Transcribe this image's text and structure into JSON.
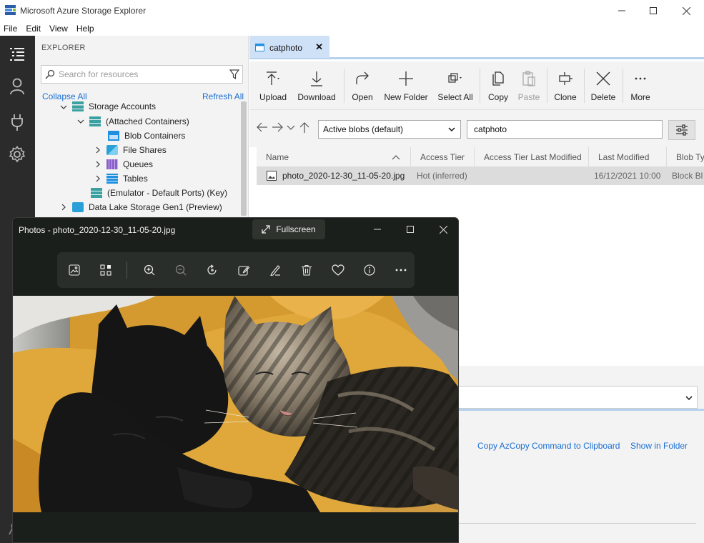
{
  "window": {
    "title": "Microsoft Azure Storage Explorer",
    "minimize_icon": "minimize-icon",
    "maximize_icon": "maximize-icon",
    "close_icon": "close-icon"
  },
  "menu": [
    "File",
    "Edit",
    "View",
    "Help"
  ],
  "activity_bar": [
    "explorer-icon",
    "account-icon",
    "plug-icon",
    "settings-icon"
  ],
  "explorer": {
    "title": "EXPLORER",
    "search_placeholder": "Search for resources",
    "collapse_all": "Collapse All",
    "refresh_all": "Refresh All",
    "tree": [
      {
        "label": "Storage Accounts",
        "expanded": true
      },
      {
        "label": "(Attached Containers)",
        "expanded": true
      },
      {
        "label": "Blob Containers"
      },
      {
        "label": "File Shares",
        "expanded": false
      },
      {
        "label": "Queues",
        "expanded": false
      },
      {
        "label": "Tables",
        "expanded": false
      },
      {
        "label": "(Emulator - Default Ports) (Key)"
      },
      {
        "label": "Data Lake Storage Gen1 (Preview)",
        "expanded": false
      }
    ]
  },
  "tab": {
    "label": "catphoto",
    "close": "✕"
  },
  "toolbar": {
    "upload": "Upload",
    "download": "Download",
    "open": "Open",
    "new_folder": "New Folder",
    "select_all": "Select All",
    "copy": "Copy",
    "paste": "Paste",
    "clone": "Clone",
    "delete": "Delete",
    "more": "More"
  },
  "nav": {
    "view_select": "Active blobs (default)",
    "path": "catphoto"
  },
  "grid": {
    "columns": [
      "Name",
      "Access Tier",
      "Access Tier Last Modified",
      "Last Modified",
      "Blob Ty"
    ],
    "rows": [
      {
        "name": "photo_2020-12-30_11-05-20.jpg",
        "access_tier": "Hot (inferred)",
        "access_tier_last_modified": "",
        "last_modified": "16/12/2021 10:00",
        "blob_type": "Block Bl"
      }
    ]
  },
  "actions": {
    "copy_azcopy": "Copy AzCopy Command to Clipboard",
    "show_in_folder": "Show in Folder"
  },
  "photos": {
    "title": "Photos - photo_2020-12-30_11-05-20.jpg",
    "fullscreen": "Fullscreen",
    "toolbar_icons": [
      "image-icon",
      "gallery-icon",
      "zoom-in-icon",
      "zoom-out-icon",
      "rotate-icon",
      "edit-image-icon",
      "draw-icon",
      "delete-icon",
      "favorite-icon",
      "info-icon",
      "more-icon"
    ]
  },
  "colors": {
    "accent": "#1a6fd3",
    "activity_bar": "#2b2b2b",
    "tab_active": "#cfe1f7",
    "photos_bg": "#1b1f1b"
  }
}
